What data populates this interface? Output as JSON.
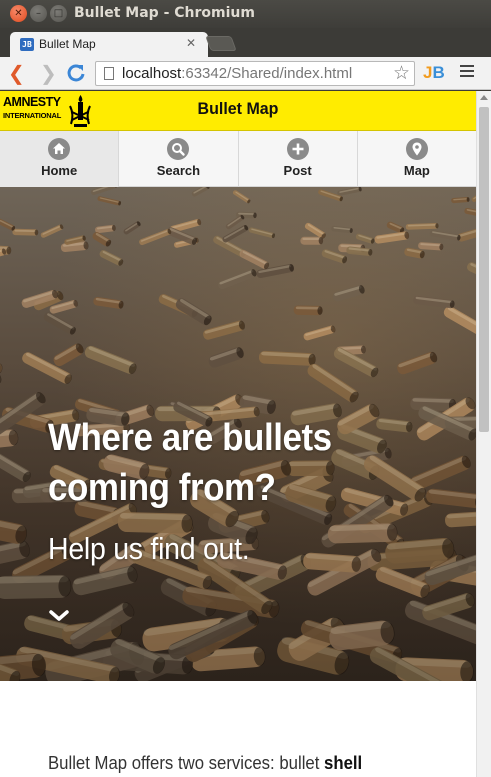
{
  "window": {
    "title": "Bullet Map - Chromium"
  },
  "tab": {
    "title": "Bullet Map",
    "favicon_text": "JB"
  },
  "address_bar": {
    "host": "localhost",
    "rest": ":63342/Shared/index.html"
  },
  "extension": {
    "label_j": "J",
    "label_b": "B"
  },
  "app": {
    "logo": {
      "line1": "AMNESTY",
      "line2": "INTERNATIONAL"
    },
    "title": "Bullet Map",
    "nav": [
      {
        "label": "Home",
        "icon": "home-icon",
        "active": true
      },
      {
        "label": "Search",
        "icon": "search-icon",
        "active": false
      },
      {
        "label": "Post",
        "icon": "plus-icon",
        "active": false
      },
      {
        "label": "Map",
        "icon": "map-pin-icon",
        "active": false
      }
    ],
    "accent_color": "#ffec00"
  },
  "hero": {
    "headline": "Where are bullets coming from?",
    "subheadline": "Help us find out.",
    "scroll_icon": "chevron-down-icon"
  },
  "intro": {
    "text_start": "Bullet Map offers two services: bullet ",
    "text_bold": "shell"
  }
}
